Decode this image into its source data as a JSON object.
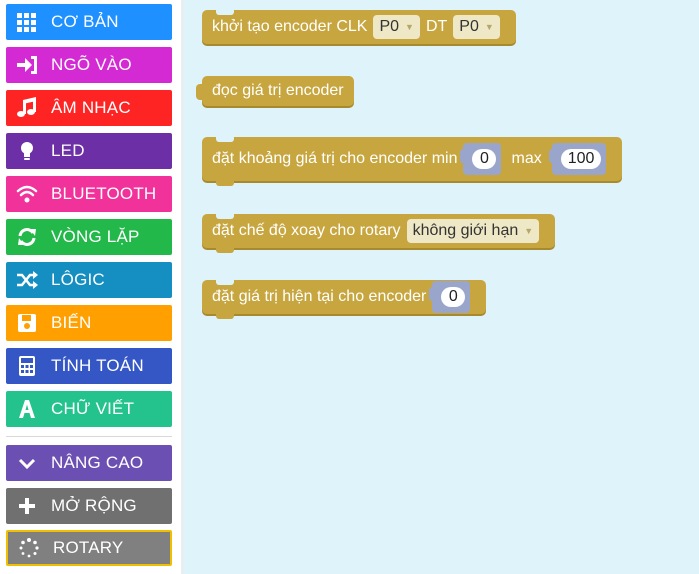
{
  "sidebar": {
    "categories": [
      {
        "label": "CƠ BẢN",
        "icon": "grid-icon",
        "color": "#1e90ff"
      },
      {
        "label": "NGÕ VÀO",
        "icon": "sign-in-icon",
        "color": "#d42ad4"
      },
      {
        "label": "ÂM NHẠC",
        "icon": "music-note-icon",
        "color": "#ff2424"
      },
      {
        "label": "LED",
        "icon": "lightbulb-icon",
        "color": "#6c2fa6"
      },
      {
        "label": "BLUETOOTH",
        "icon": "wifi-icon",
        "color": "#f0329a"
      },
      {
        "label": "VÒNG LẶP",
        "icon": "refresh-icon",
        "color": "#23b84a"
      },
      {
        "label": "LÔGIC",
        "icon": "shuffle-icon",
        "color": "#158fc2"
      },
      {
        "label": "BIẾN",
        "icon": "save-icon",
        "color": "#ff9f00"
      },
      {
        "label": "TÍNH TOÁN",
        "icon": "calculator-icon",
        "color": "#3457c5"
      },
      {
        "label": "CHỮ VIẾT",
        "icon": "font-icon",
        "color": "#24c38e"
      },
      {
        "label": "NÂNG CAO",
        "icon": "chevron-down-icon",
        "color": "#6c4fb2"
      },
      {
        "label": "MỞ RỘNG",
        "icon": "plus-icon",
        "color": "#707070"
      },
      {
        "label": "ROTARY",
        "icon": "spinner-icon",
        "color": "#808080",
        "selected": true
      }
    ]
  },
  "workspace": {
    "init_block": {
      "text": "khởi tạo encoder CLK",
      "clk_value": "P0",
      "dt_label": "DT",
      "dt_value": "P0"
    },
    "read_block": {
      "text": "đọc giá trị encoder"
    },
    "range_block": {
      "text": "đặt khoảng giá trị cho encoder min",
      "min_value": "0",
      "max_label": "max",
      "max_value": "100"
    },
    "mode_block": {
      "text": "đặt chế độ xoay cho rotary",
      "mode_value": "không giới hạn"
    },
    "set_block": {
      "text": "đặt giá trị hiện tại cho encoder",
      "value": "0"
    }
  },
  "colors": {
    "workspace_bg": "#dff3fb",
    "block": "#c8a63f",
    "value_slot": "#9aa5cc",
    "dropdown": "#eee8c6",
    "selected_outline": "#f0c000"
  }
}
